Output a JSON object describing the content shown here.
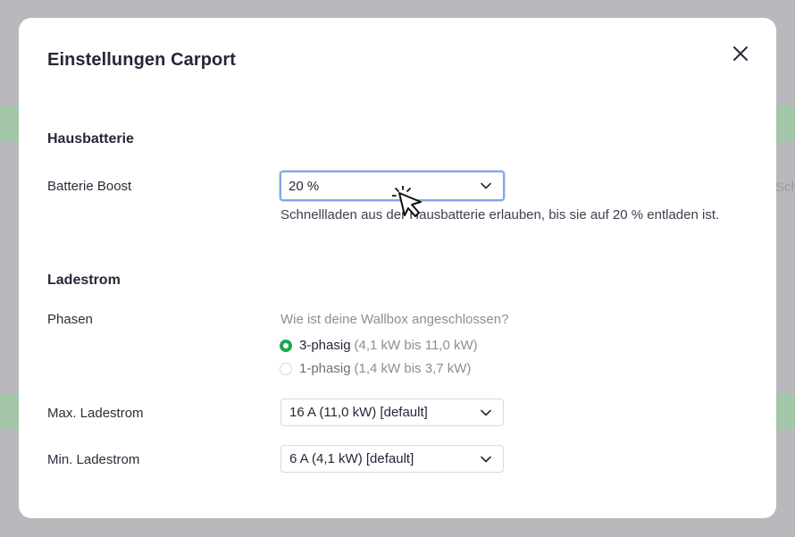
{
  "background": {
    "partial_text": "Sch"
  },
  "modal": {
    "title": "Einstellungen Carport",
    "close_icon": "close-icon"
  },
  "hausbatterie": {
    "section_title": "Hausbatterie",
    "boost_label": "Batterie Boost",
    "boost_value": "20 %",
    "boost_help": "Schnellladen aus der Hausbatterie erlauben, bis sie auf 20 % entladen ist."
  },
  "ladestrom": {
    "section_title": "Ladestrom",
    "phasen_label": "Phasen",
    "phasen_question": "Wie ist deine Wallbox angeschlossen?",
    "phase_options": [
      {
        "label": "3-phasig",
        "detail": "(4,1 kW bis 11,0 kW)",
        "selected": true
      },
      {
        "label": "1-phasig",
        "detail": "(1,4 kW bis 3,7 kW)",
        "selected": false
      }
    ],
    "max_label": "Max. Ladestrom",
    "max_value": "16 A (11,0 kW) [default]",
    "min_label": "Min. Ladestrom",
    "min_value": "6 A (4,1 kW) [default]"
  },
  "colors": {
    "accent_green": "#1fa84c",
    "focus_blue": "#7fa8e8",
    "overlay": "#b9b9bd"
  }
}
